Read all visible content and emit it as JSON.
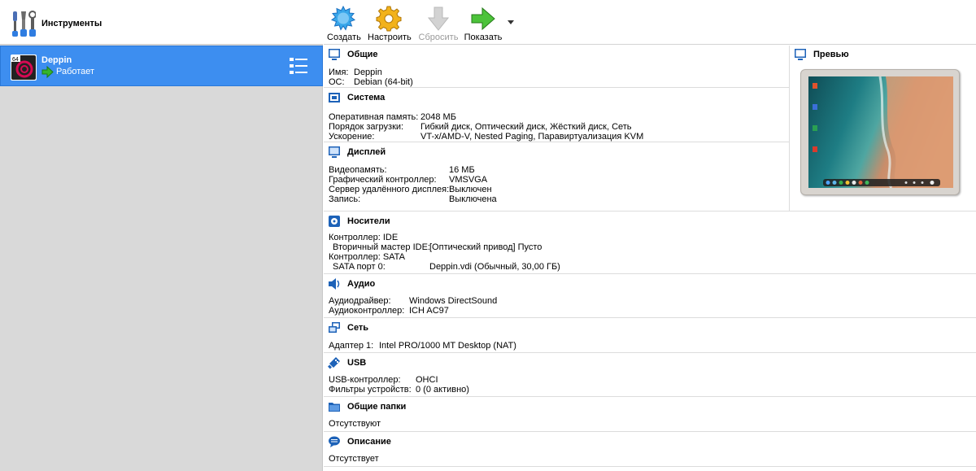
{
  "left_pane": {
    "tools_label": "Инструменты",
    "vm": {
      "name": "Deppin",
      "state": "Работает",
      "os_badge": "64"
    }
  },
  "toolbar": {
    "create": "Создать",
    "settings": "Настроить",
    "reset": "Сбросить",
    "show": "Показать"
  },
  "sections": {
    "general": {
      "title": "Общие",
      "rows": [
        {
          "key": "Имя:",
          "value": "Deppin"
        },
        {
          "key": "ОС:",
          "value": "Debian (64-bit)"
        }
      ]
    },
    "system": {
      "title": "Система",
      "rows": [
        {
          "key": "Оперативная память:",
          "value": "2048 МБ"
        },
        {
          "key": "Порядок загрузки:",
          "value": "Гибкий диск, Оптический диск, Жёсткий диск, Сеть"
        },
        {
          "key": "Ускорение:",
          "value": "VT-x/AMD-V, Nested Paging, Паравиртуализация KVM"
        }
      ]
    },
    "display": {
      "title": "Дисплей",
      "rows": [
        {
          "key": "Видеопамять:",
          "value": "16 МБ"
        },
        {
          "key": "Графический контроллер:",
          "value": "VMSVGA"
        },
        {
          "key": "Сервер удалённого дисплея:",
          "value": "Выключен"
        },
        {
          "key": "Запись:",
          "value": "Выключена"
        }
      ]
    },
    "storage": {
      "title": "Носители",
      "rows": [
        {
          "key": "Контроллер: IDE",
          "value": ""
        },
        {
          "key": "Вторичный мастер IDE:",
          "value": "[Оптический привод] Пусто"
        },
        {
          "key": "Контроллер: SATA",
          "value": ""
        },
        {
          "key": "SATA порт 0:",
          "value": "Deppin.vdi (Обычный, 30,00 ГБ)"
        }
      ]
    },
    "audio": {
      "title": "Аудио",
      "rows": [
        {
          "key": "Аудиодрайвер:",
          "value": "Windows DirectSound"
        },
        {
          "key": "Аудиоконтроллер:",
          "value": "ICH AC97"
        }
      ]
    },
    "network": {
      "title": "Сеть",
      "rows": [
        {
          "key": "Адаптер 1:",
          "value": "Intel PRO/1000 MT Desktop (NAT)"
        }
      ]
    },
    "usb": {
      "title": "USB",
      "rows": [
        {
          "key": "USB-контроллер:",
          "value": "OHCI"
        },
        {
          "key": "Фильтры устройств:",
          "value": "0 (0 активно)"
        }
      ]
    },
    "shared": {
      "title": "Общие папки",
      "rows": [
        {
          "key": "Отсутствуют",
          "value": ""
        }
      ]
    },
    "description": {
      "title": "Описание",
      "rows": [
        {
          "key": "Отсутствует",
          "value": ""
        }
      ]
    },
    "preview": {
      "title": "Превью"
    }
  },
  "colors": {
    "selection": "#3d8ef0",
    "left_background": "#d9d9d9",
    "section_icon": "#1d62b8"
  },
  "icons": {
    "tools": "tools-icon",
    "os": "debian-os-icon",
    "state": "running-arrow-icon",
    "vm_menu": "vm-menu-icon",
    "create": "new-vm-icon",
    "settings": "settings-gear-icon",
    "reset": "reset-arrow-icon",
    "show": "show-arrow-icon"
  }
}
